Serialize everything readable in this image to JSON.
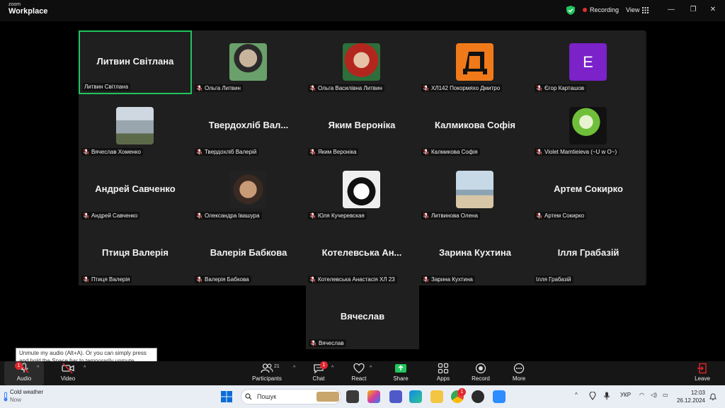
{
  "titlebar": {
    "brand_small": "zoom",
    "brand_big": "Workplace",
    "recording": "Recording",
    "view": "View",
    "icons": [
      "shield-check-icon",
      "grid-icon",
      "minimize-icon",
      "restore-icon",
      "close-icon"
    ]
  },
  "colors": {
    "active_border": "#21c45c",
    "mute_red": "#e0262d",
    "panel": "#1a1a1a"
  },
  "participants": [
    {
      "display": "Литвин Світлана",
      "label": "Литвин Світлана",
      "active": true,
      "muted": false
    },
    {
      "display": "",
      "label": "Ольга Литвин",
      "avatar": "photo-woman",
      "muted": true
    },
    {
      "display": "",
      "label": "Ольга Василівна Литвин",
      "avatar": "photo-woman-glasses",
      "muted": true
    },
    {
      "display": "",
      "label": "ХЛ142 Покормяхо Дмитро",
      "avatar": "letter-logo-orange",
      "muted": true
    },
    {
      "display": "",
      "label": "Єгор Карташов",
      "avatar": "letter-E",
      "avatar_text": "E",
      "muted": true
    },
    {
      "display": "",
      "label": "Вячеслав Хоменко",
      "avatar": "photo-street",
      "muted": true
    },
    {
      "display": "Твердохліб Вал...",
      "label": "Твердохліб Валерій",
      "muted": true
    },
    {
      "display": "Яким Вероніка",
      "label": "Яким Вероніка",
      "muted": true
    },
    {
      "display": "Калмикова Софія",
      "label": "Калмикова Софія",
      "muted": true
    },
    {
      "display": "",
      "label": "Violet Mamtieieva (~U w O~)",
      "avatar": "anime-character",
      "muted": true
    },
    {
      "display": "Андрей Савченко",
      "label": "Андрей Савченко",
      "muted": true
    },
    {
      "display": "",
      "label": "Олександра Івашура",
      "avatar": "photo-smiling",
      "muted": true
    },
    {
      "display": "",
      "label": "Юля Кучеревская",
      "avatar": "illustration-bw",
      "muted": true
    },
    {
      "display": "",
      "label": "Литвинова Олена",
      "avatar": "photo-beach",
      "muted": true
    },
    {
      "display": "Артем Сокирко",
      "label": "Артем Сокирко",
      "muted": true
    },
    {
      "display": "Птиця Валерія",
      "label": "Птиця Валерія",
      "muted": true
    },
    {
      "display": "Валерія Бабкова",
      "label": "Валерія Бабкова",
      "muted": true
    },
    {
      "display": "Котелевська Ан...",
      "label": "Котелевська Анастасія ХЛ 23",
      "muted": true
    },
    {
      "display": "Зарина Кухтина",
      "label": "Зарина Кухтина",
      "muted": true
    },
    {
      "display": "Ілля Грабазій",
      "label": "Ілля Грабазій",
      "muted": false
    },
    {
      "display": "Вячеслав",
      "label": "Вячеслав",
      "muted": true
    }
  ],
  "tooltip": "Unmute my audio (Alt+A). Or you can simply press and hold the Space bar to temporarily unmute.",
  "toolbar": {
    "audio": "Audio",
    "video": "Video",
    "participants": "Participants",
    "participants_count": "21",
    "chat": "Chat",
    "chat_badge": "1",
    "react": "React",
    "share": "Share",
    "apps": "Apps",
    "record": "Record",
    "more": "More",
    "leave": "Leave",
    "audio_badge": "1"
  },
  "taskbar": {
    "weather_title": "Cold weather",
    "weather_sub": "Now",
    "search_placeholder": "Пошук",
    "lang": "УКР",
    "time": "12:03",
    "date": "26.12.2024",
    "chrome_badge": "1"
  }
}
